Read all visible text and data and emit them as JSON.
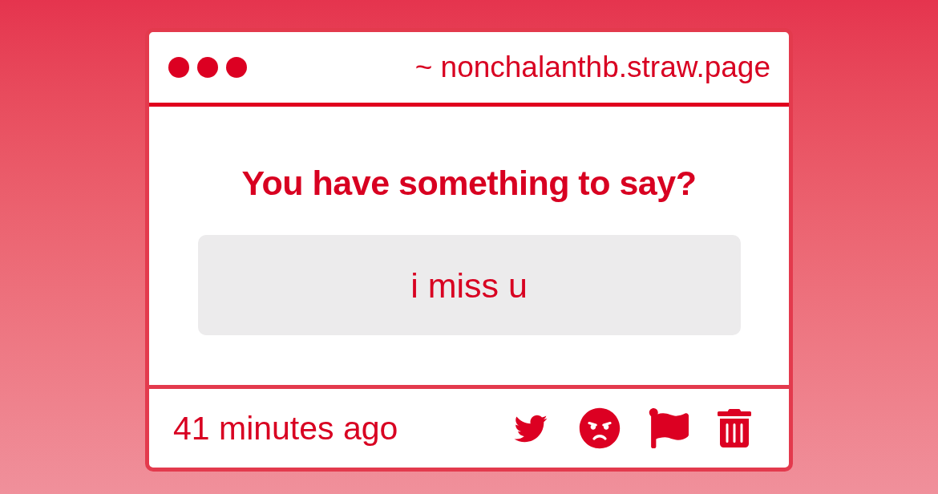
{
  "window": {
    "address": "~ nonchalanthb.straw.page"
  },
  "prompt": {
    "title": "You have something to say?",
    "message": "i miss u"
  },
  "footer": {
    "time": "41 minutes ago"
  }
}
